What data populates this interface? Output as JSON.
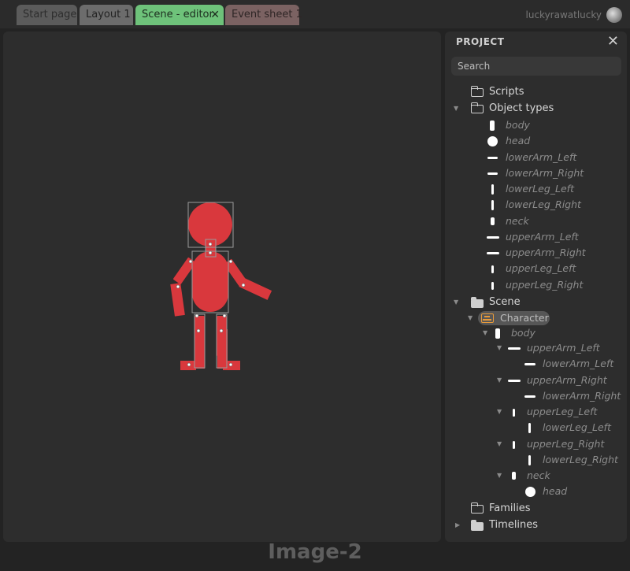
{
  "tabs": [
    "Start page",
    "Layout 1",
    "Scene - editor",
    "Event sheet 1"
  ],
  "tab_close_glyph": "✕",
  "user": {
    "name": "luckyrawatlucky"
  },
  "project": {
    "title": "PROJECT",
    "close_glyph": "✕",
    "search_placeholder": "Search",
    "scripts": "Scripts",
    "object_types_label": "Object types",
    "object_types": [
      "body",
      "head",
      "lowerArm_Left",
      "lowerArm_Right",
      "lowerLeg_Left",
      "lowerLeg_Right",
      "neck",
      "upperArm_Left",
      "upperArm_Right",
      "upperLeg_Left",
      "upperLeg_Right"
    ],
    "scene_label": "Scene",
    "character": "Character",
    "scene_tree": [
      "body",
      "upperArm_Left",
      "lowerArm_Left",
      "upperArm_Right",
      "lowerArm_Right",
      "upperLeg_Left",
      "lowerLeg_Left",
      "upperLeg_Right",
      "lowerLeg_Right",
      "neck",
      "head"
    ],
    "families": "Families",
    "timelines": "Timelines"
  },
  "caption": "Image-2",
  "colors": {
    "figure_red": "#d9383d",
    "active_tab": "#6ec27a",
    "accent_orange": "#e89a3a"
  }
}
